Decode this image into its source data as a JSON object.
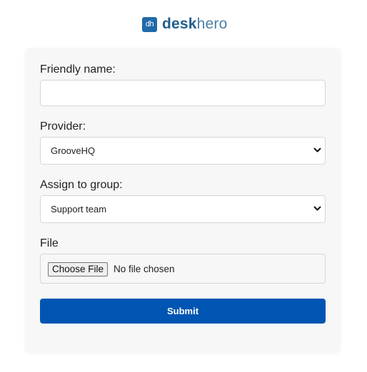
{
  "brand": {
    "logo_mark": "dh",
    "name_part1": "desk",
    "name_part2": "hero",
    "color": "#1f6aa8"
  },
  "form": {
    "friendly_name": {
      "label": "Friendly name:",
      "value": "",
      "placeholder": ""
    },
    "provider": {
      "label": "Provider:",
      "selected": "GrooveHQ",
      "icon": "chevron-down-icon"
    },
    "group": {
      "label": "Assign to group:",
      "selected": "Support team",
      "icon": "chevron-down-icon"
    },
    "file": {
      "label": "File",
      "button": "Choose File",
      "status": "No file chosen"
    },
    "submit": {
      "label": "Submit",
      "color": "#0055b3"
    }
  }
}
